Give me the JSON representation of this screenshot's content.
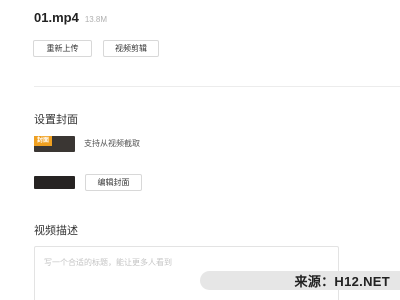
{
  "file": {
    "name": "01.mp4",
    "size": "13.8M"
  },
  "actions": {
    "reupload_label": "重新上传",
    "clip_label": "视频剪辑"
  },
  "cover": {
    "title": "设置封面",
    "thumb_tag": "封面",
    "support_text": "支持从视频截取",
    "edit_label": "编辑封面"
  },
  "description": {
    "title": "视频描述",
    "placeholder": "写一个合适的标题，能让更多人看到"
  },
  "watermark": {
    "text": "来源：H12.NET"
  },
  "colors": {
    "accent": "#f0a020",
    "border": "#d8d8d8",
    "thumbnail": "#3a3633"
  }
}
